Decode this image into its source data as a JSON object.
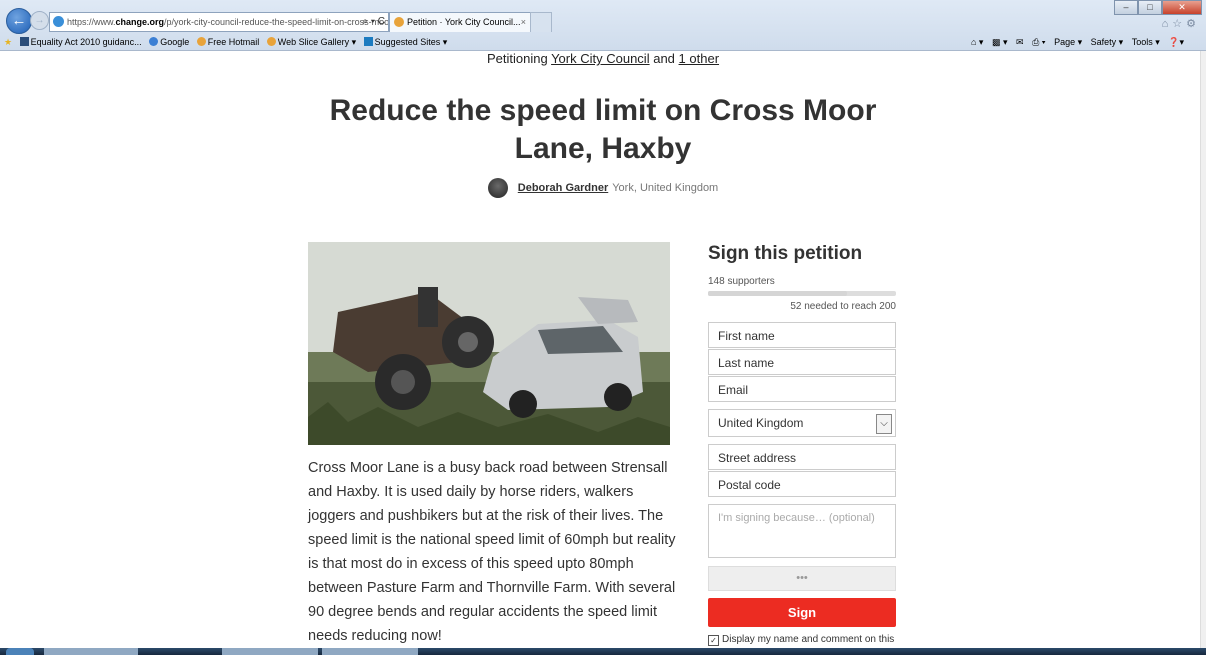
{
  "browser": {
    "address_prefix": "https://www.",
    "address_domain": "change.org",
    "address_rest": "/p/york-city-council-reduce-the-speed-limit-on-cross-moor-la",
    "address_tools": "⌕ ▾ C",
    "tab_title": "Petition · York City Council...",
    "tab_close": "×",
    "favorites": [
      "Equality Act 2010 guidanc...",
      "Google",
      "Free Hotmail",
      "Web Slice Gallery ▾",
      "Suggested Sites ▾"
    ],
    "commands": [
      "Page ▾",
      "Safety ▾",
      "Tools ▾"
    ]
  },
  "page": {
    "petitioning_prefix": "Petitioning",
    "petitioning_target": "York City Council",
    "petitioning_and": "and",
    "petitioning_other": "1 other",
    "title": "Reduce the speed limit on Cross Moor Lane, Haxby",
    "author_name": "Deborah Gardner",
    "author_location": "York, United Kingdom",
    "description": "Cross Moor Lane is a busy back road between Strensall and Haxby. It is used daily by horse riders, walkers joggers and pushbikers but at the risk of their lives. The speed limit is the national speed limit of 60mph but reality is that most do in excess of this speed upto 80mph between Pasture Farm and Thornville Farm. With several 90 degree bends and regular accidents the speed limit needs reducing now!"
  },
  "sign_form": {
    "title": "Sign this petition",
    "supporters": "148 supporters",
    "progress_fraction": 0.74,
    "needed": "52 needed to reach 200",
    "first_name_placeholder": "First name",
    "last_name_placeholder": "Last name",
    "email_placeholder": "Email",
    "country": "United Kingdom",
    "street_placeholder": "Street address",
    "postal_placeholder": "Postal code",
    "comment_placeholder": "I'm signing because… (optional)",
    "captcha": "•••",
    "sign_label": "Sign",
    "display_option": "Display my name and comment on this",
    "display_checked": "✓"
  },
  "colors": {
    "sign_button": "#ec2c22",
    "title_text": "#333333"
  }
}
